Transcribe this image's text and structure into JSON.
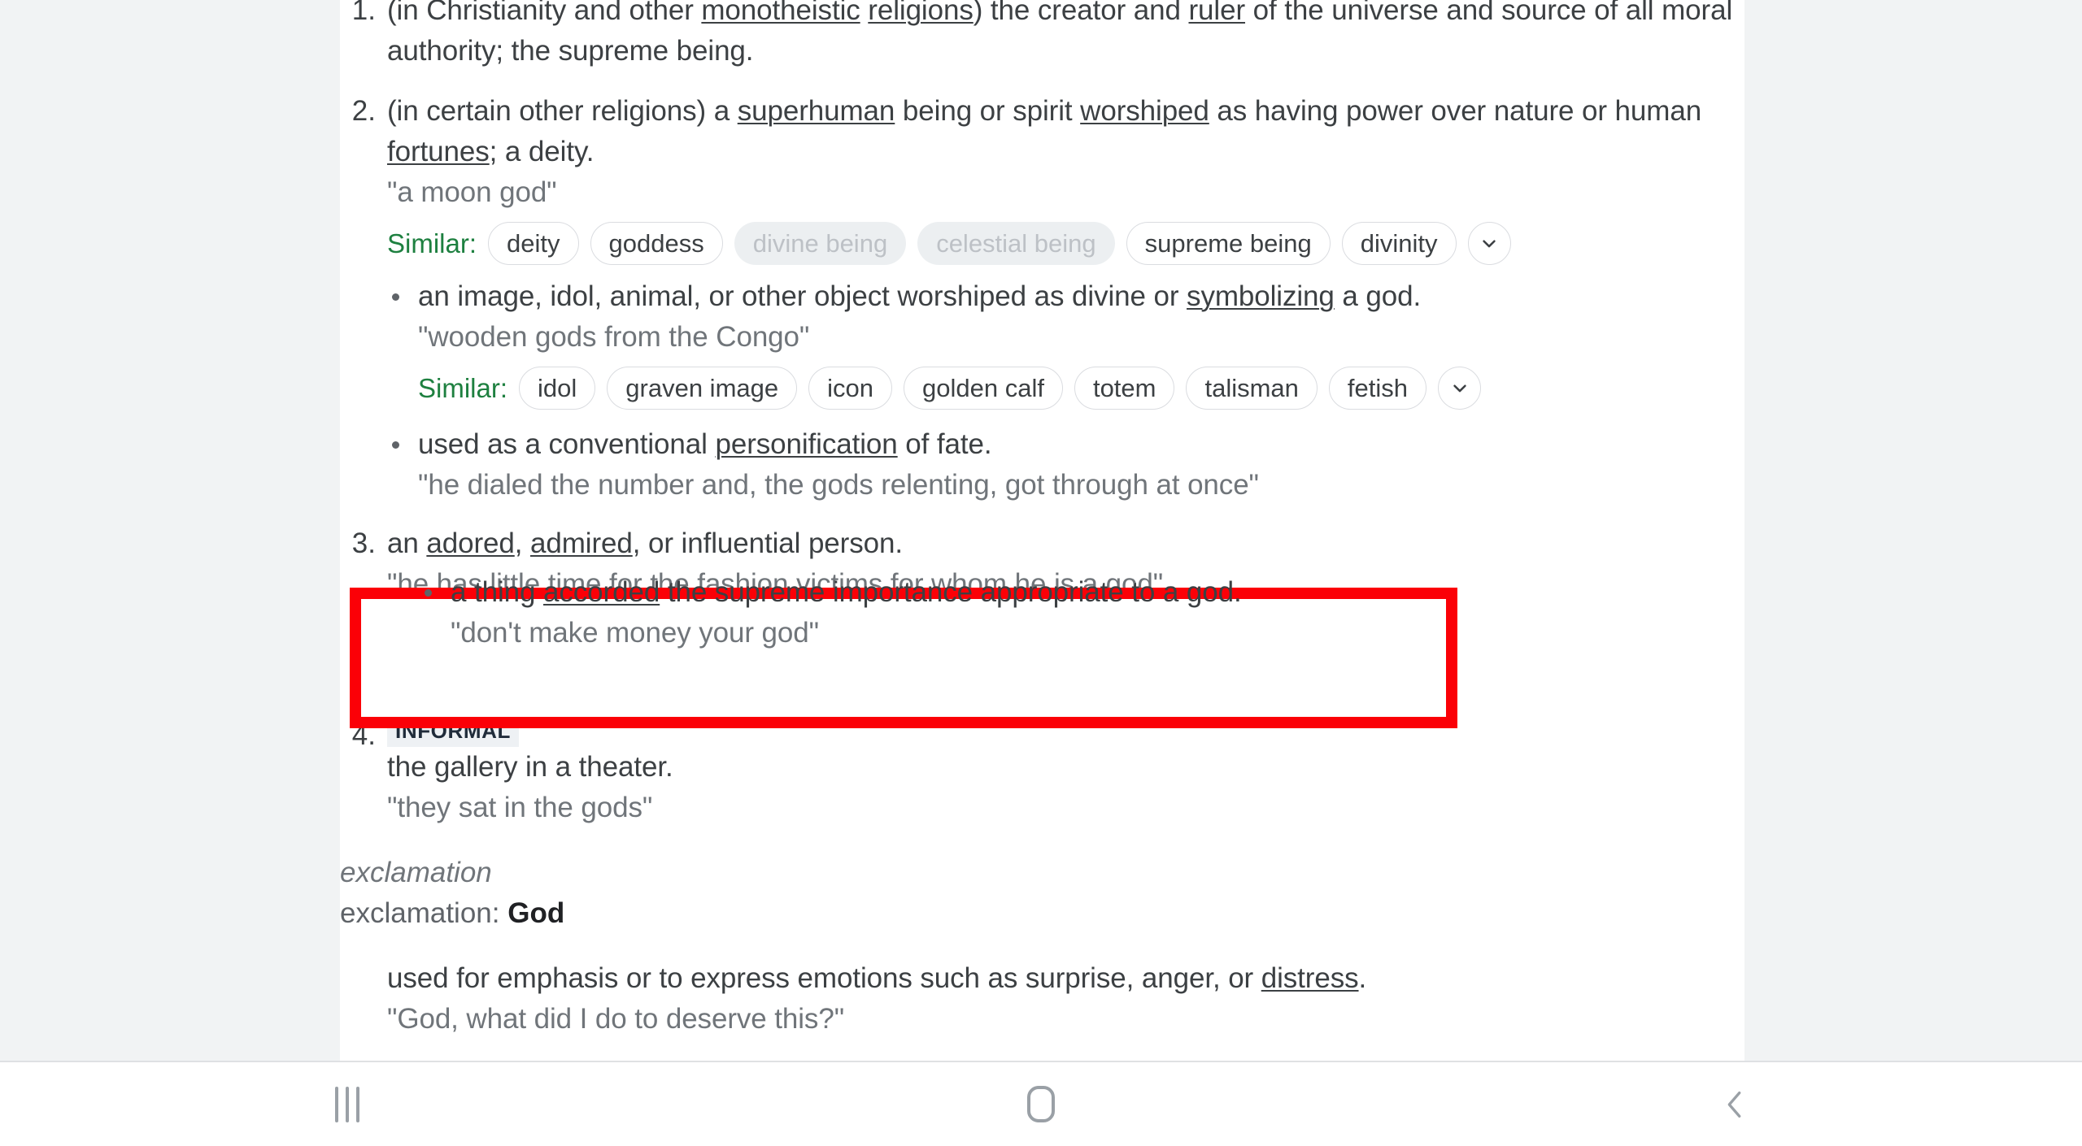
{
  "colors": {
    "page_background": "#f1f3f4",
    "card_background": "#ffffff",
    "body_text": "#3c4043",
    "quote_text": "#70757a",
    "similar_label_green": "#1e8040",
    "annotation_red": "#fb0007",
    "badge_background": "#eef1f4",
    "badge_text": "#202c3a",
    "nav_icon": "#9aa0a6"
  },
  "entry": {
    "senses": [
      {
        "number": "1.",
        "definition_parts": [
          {
            "text": "(in Christianity and other ",
            "link": false
          },
          {
            "text": "monotheistic",
            "link": true
          },
          {
            "text": " ",
            "link": false
          },
          {
            "text": "religions",
            "link": true
          },
          {
            "text": ") the creator and ",
            "link": false
          },
          {
            "text": "ruler",
            "link": true
          },
          {
            "text": " of the universe and source of all moral authority; the supreme being.",
            "link": false
          }
        ]
      },
      {
        "number": "2.",
        "definition_parts": [
          {
            "text": "(in certain other religions) a ",
            "link": false
          },
          {
            "text": "superhuman",
            "link": true
          },
          {
            "text": " being or spirit ",
            "link": false
          },
          {
            "text": "worshiped",
            "link": true
          },
          {
            "text": " as having power over nature or human ",
            "link": false
          },
          {
            "text": "fortunes",
            "link": true
          },
          {
            "text": "; a deity.",
            "link": false
          }
        ],
        "example": "\"a moon god\"",
        "similar": {
          "label": "Similar:",
          "chips": [
            {
              "text": "deity",
              "muted": false
            },
            {
              "text": "goddess",
              "muted": false
            },
            {
              "text": "divine being",
              "muted": true
            },
            {
              "text": "celestial being",
              "muted": true
            },
            {
              "text": "supreme being",
              "muted": false
            },
            {
              "text": "divinity",
              "muted": false
            }
          ],
          "expand_icon": "chevron-down-icon"
        },
        "sub_items": [
          {
            "definition_parts": [
              {
                "text": "an image, idol, animal, or other object worshiped as divine or ",
                "link": false
              },
              {
                "text": "symbolizing",
                "link": true
              },
              {
                "text": " a god.",
                "link": false
              }
            ],
            "example": "\"wooden gods from the Congo\"",
            "similar": {
              "label": "Similar:",
              "chips": [
                {
                  "text": "idol",
                  "muted": false
                },
                {
                  "text": "graven image",
                  "muted": false
                },
                {
                  "text": "icon",
                  "muted": false
                },
                {
                  "text": "golden calf",
                  "muted": false
                },
                {
                  "text": "totem",
                  "muted": false
                },
                {
                  "text": "talisman",
                  "muted": false
                },
                {
                  "text": "fetish",
                  "muted": false
                }
              ],
              "expand_icon": "chevron-down-icon"
            }
          },
          {
            "definition_parts": [
              {
                "text": "used as a conventional ",
                "link": false
              },
              {
                "text": "personification",
                "link": true
              },
              {
                "text": " of fate.",
                "link": false
              }
            ],
            "example": "\"he dialed the number and, the gods relenting, got through at once\""
          }
        ]
      },
      {
        "number": "3.",
        "definition_parts": [
          {
            "text": "an ",
            "link": false
          },
          {
            "text": "adored",
            "link": true
          },
          {
            "text": ", ",
            "link": false
          },
          {
            "text": "admired",
            "link": true
          },
          {
            "text": ", or influential person.",
            "link": false
          }
        ],
        "example": "\"he has little time for the fashion victims for whom he is a god\"",
        "sub_items": [
          {
            "definition_parts": [
              {
                "text": "a thing ",
                "link": false
              },
              {
                "text": "accorded",
                "link": true
              },
              {
                "text": " the supreme importance appropriate to a god.",
                "link": false
              }
            ],
            "example": "\"don't make money your god\""
          }
        ]
      },
      {
        "number": "4.",
        "register_badge": "INFORMAL",
        "definition_plain": "the gallery in a theater.",
        "example": "\"they sat in the gods\""
      }
    ],
    "exclamation_section": {
      "part_of_speech": "exclamation",
      "headword_line_prefix": "exclamation",
      "headword_line_separator": ": ",
      "headword": "God",
      "definition_parts": [
        {
          "text": "used for emphasis or to express emotions such as surprise, anger, or ",
          "link": false
        },
        {
          "text": "distress",
          "link": true
        },
        {
          "text": ".",
          "link": false
        }
      ],
      "example": "\"God, what did I do to deserve this?\""
    }
  },
  "annotation": {
    "name": "red-highlight-rectangle",
    "highlighted_definition_parts": [
      {
        "text": "a thing ",
        "link": false
      },
      {
        "text": "accorded",
        "link": true
      },
      {
        "text": " the supreme importance appropriate to a god.",
        "link": false
      }
    ],
    "highlighted_example": "\"don't make money your god\""
  },
  "nav_bar": {
    "recents_icon": "recents-icon",
    "home_icon": "home-icon",
    "back_icon": "back-chevron-icon"
  }
}
